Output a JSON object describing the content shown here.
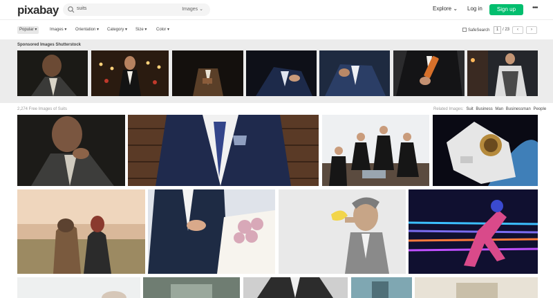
{
  "header": {
    "logo": "pixabay",
    "search_value": "suits",
    "search_type": "Images",
    "explore_label": "Explore",
    "login_label": "Log in",
    "signup_label": "Sign up",
    "more_label": "•••",
    "brand_color": "#02be6e"
  },
  "filters": {
    "popular": "Popular ▾",
    "images": "Images ▾",
    "orientation": "Orientation ▾",
    "category": "Category ▾",
    "size": "Size ▾",
    "color": "Color ▾",
    "safesearch": "SafeSearch",
    "page_current": "1",
    "page_total": "/ 23",
    "prev": "‹",
    "next": "›"
  },
  "sponsored": {
    "title": "Sponsored Images Shutterstock"
  },
  "results": {
    "count_text": "2,274 Free Images of Suits",
    "related_label": "Related Images:",
    "related": [
      "Suit",
      "Business",
      "Man",
      "Businessman",
      "People"
    ]
  },
  "icons": {
    "search": "search-icon",
    "chevron": "chevron-down-icon",
    "more": "more-dots-icon"
  }
}
